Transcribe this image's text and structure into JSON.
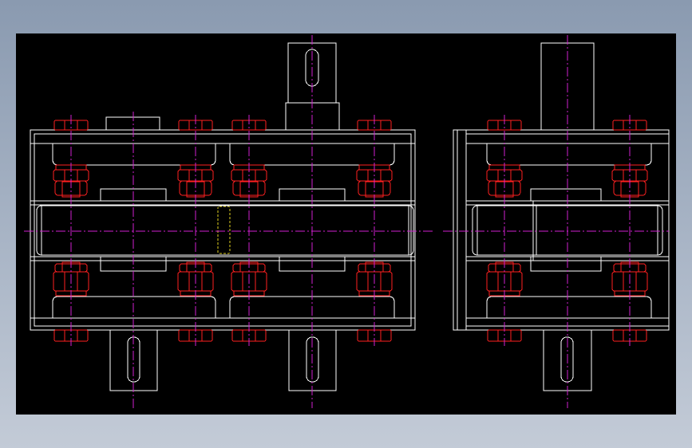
{
  "drawing": {
    "background": "#000000",
    "outline_color": "#ffffff",
    "bolt_color": "#ff2020",
    "centerline_color": "#d020d0",
    "hidden_line_color": "#e0d020",
    "views": [
      {
        "name": "front-view",
        "bolt_columns": 4,
        "lower_shafts": 2,
        "upper_shafts": 1
      },
      {
        "name": "side-view",
        "bolt_columns": 2,
        "lower_shafts": 1,
        "upper_shafts": 1
      }
    ]
  }
}
